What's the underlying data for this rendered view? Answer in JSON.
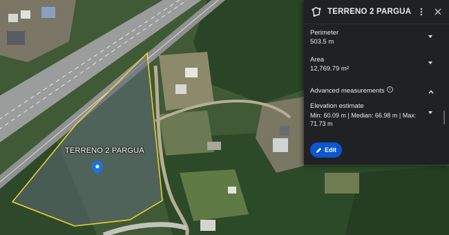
{
  "map": {
    "polygon_label": "TERRENO 2 PARGUA"
  },
  "panel": {
    "title": "TERRENO 2 PARGUA",
    "header_icon": "polygon-measure-icon",
    "perimeter": {
      "label": "Perimeter",
      "value": "503.5 m"
    },
    "area": {
      "label": "Area",
      "value": "12,769.79 m²"
    },
    "advanced": {
      "label": "Advanced measurements"
    },
    "elevation": {
      "label": "Elevation estimate",
      "value": "Min: 60.09 m | Median: 66.98 m | Max: 71.73 m"
    },
    "edit_label": "Edit"
  },
  "colors": {
    "panel_bg": "#202124",
    "accent": "#0b57d0",
    "polygon_outline": "#f5d531"
  }
}
